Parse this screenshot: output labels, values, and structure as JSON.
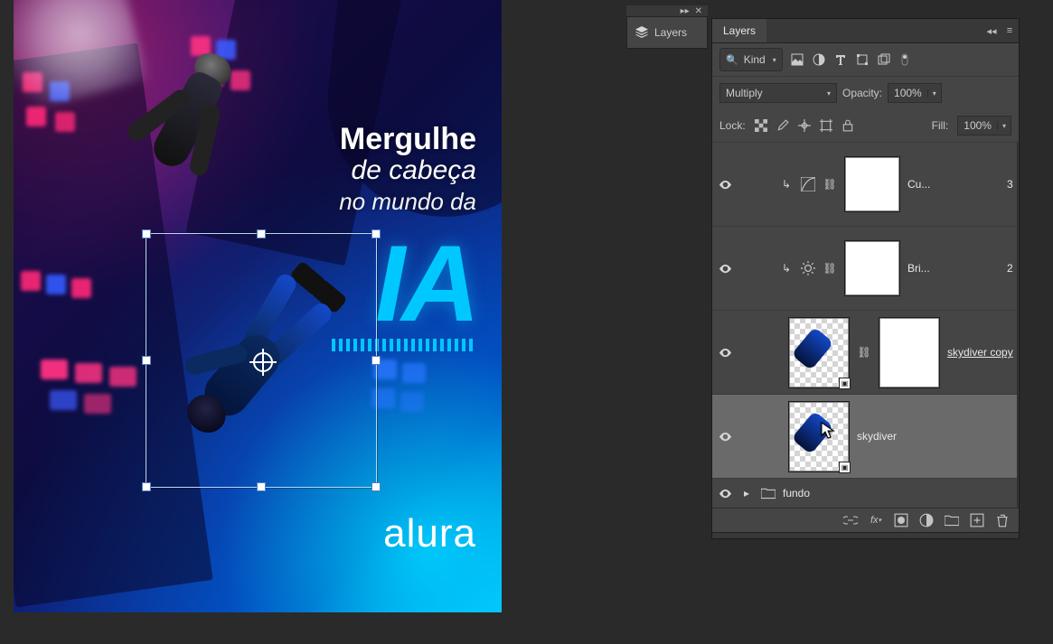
{
  "canvas": {
    "headline1": "Mergulhe",
    "headline2": "de cabeça",
    "headline3": "no mundo da",
    "big": "IA",
    "brand": "alura"
  },
  "floatTab": {
    "label": "Layers",
    "collapse": "▸▸",
    "close": "✕"
  },
  "panel": {
    "tab": "Layers",
    "menuCollapse": "◂◂",
    "menuBurger": "≡",
    "kind": {
      "search": "🔍",
      "label": "Kind"
    },
    "blend": {
      "value": "Multiply",
      "opacityLabel": "Opacity:",
      "opacityValue": "100%"
    },
    "lock": {
      "label": "Lock:",
      "fillLabel": "Fill:",
      "fillValue": "100%"
    },
    "layers": [
      {
        "name": "Cu...",
        "extra": "3"
      },
      {
        "name": "Bri...",
        "extra": "2"
      },
      {
        "name": "skydiver copy"
      },
      {
        "name": "skydiver"
      },
      {
        "name": "fundo"
      }
    ],
    "footer": {
      "link": "⌼",
      "fx": "fx",
      "mask": "▣",
      "adjust": "◐",
      "group": "📁",
      "new": "⊞",
      "trash": "🗑"
    }
  }
}
